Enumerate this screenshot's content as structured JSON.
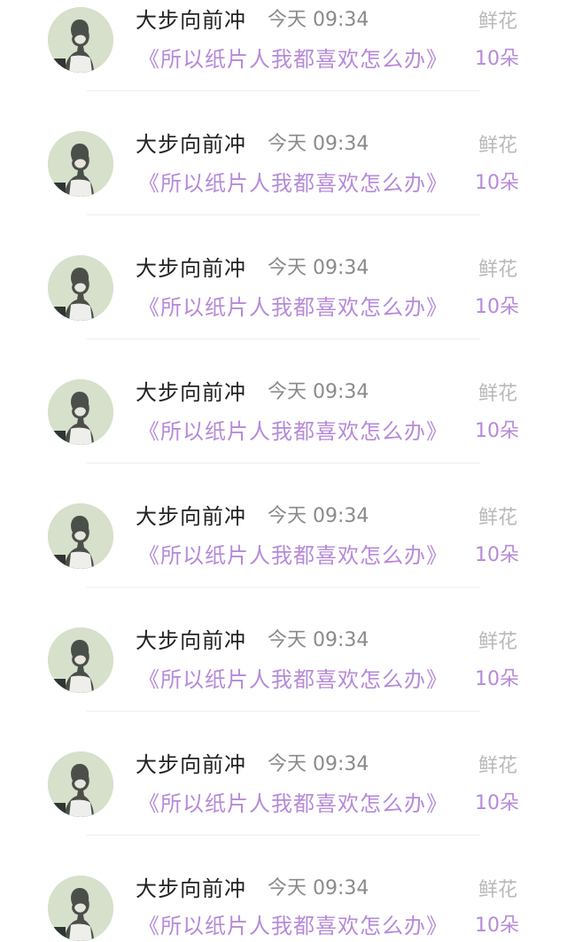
{
  "colors": {
    "name": "#222222",
    "time": "#8a8a8a",
    "gift_type": "#b9b9b9",
    "accent_purple": "#b68ad8",
    "divider": "#eeeeee",
    "background": "#ffffff"
  },
  "records": [
    {
      "icon": "user-avatar",
      "name": "大步向前冲",
      "time": "今天 09:34",
      "gift_type": "鲜花",
      "book_title": "《所以纸片人我都喜欢怎么办》",
      "count": "10朵"
    },
    {
      "icon": "user-avatar",
      "name": "大步向前冲",
      "time": "今天 09:34",
      "gift_type": "鲜花",
      "book_title": "《所以纸片人我都喜欢怎么办》",
      "count": "10朵"
    },
    {
      "icon": "user-avatar",
      "name": "大步向前冲",
      "time": "今天 09:34",
      "gift_type": "鲜花",
      "book_title": "《所以纸片人我都喜欢怎么办》",
      "count": "10朵"
    },
    {
      "icon": "user-avatar",
      "name": "大步向前冲",
      "time": "今天 09:34",
      "gift_type": "鲜花",
      "book_title": "《所以纸片人我都喜欢怎么办》",
      "count": "10朵"
    },
    {
      "icon": "user-avatar",
      "name": "大步向前冲",
      "time": "今天 09:34",
      "gift_type": "鲜花",
      "book_title": "《所以纸片人我都喜欢怎么办》",
      "count": "10朵"
    },
    {
      "icon": "user-avatar",
      "name": "大步向前冲",
      "time": "今天 09:34",
      "gift_type": "鲜花",
      "book_title": "《所以纸片人我都喜欢怎么办》",
      "count": "10朵"
    },
    {
      "icon": "user-avatar",
      "name": "大步向前冲",
      "time": "今天 09:34",
      "gift_type": "鲜花",
      "book_title": "《所以纸片人我都喜欢怎么办》",
      "count": "10朵"
    },
    {
      "icon": "user-avatar",
      "name": "大步向前冲",
      "time": "今天 09:34",
      "gift_type": "鲜花",
      "book_title": "《所以纸片人我都喜欢怎么办》",
      "count": "10朵"
    }
  ]
}
